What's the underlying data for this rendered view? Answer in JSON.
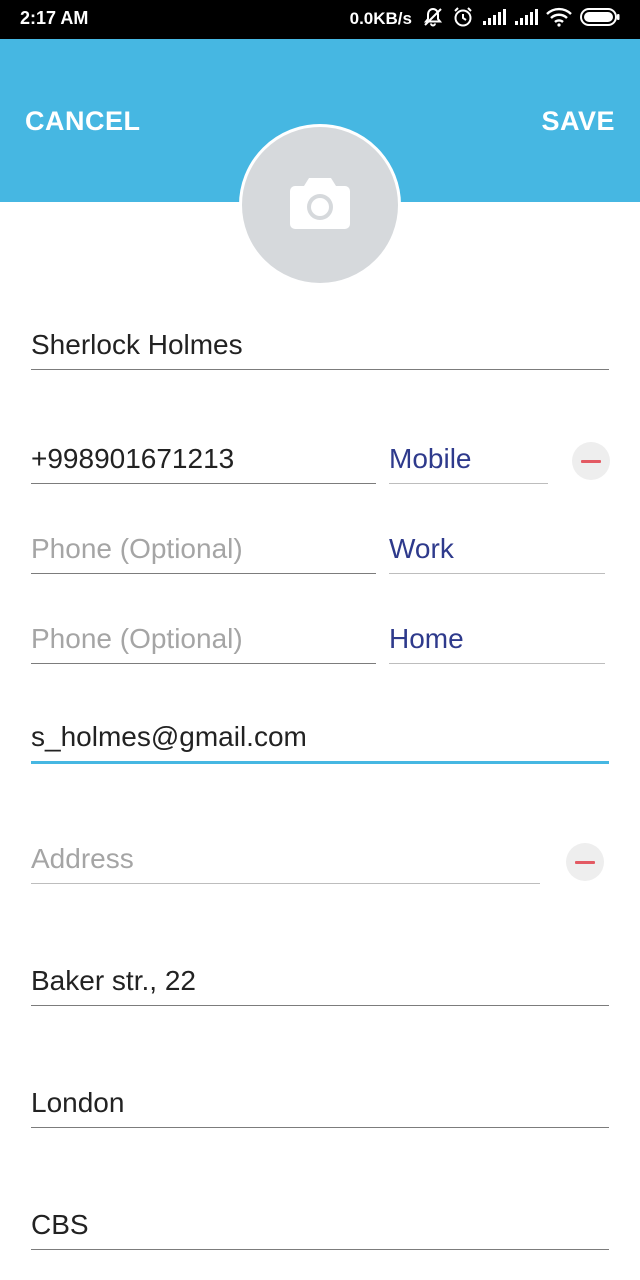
{
  "status_bar": {
    "time": "2:17 AM",
    "network_speed": "0.0KB/s",
    "icons": [
      "mute-icon",
      "alarm-icon",
      "signal-icon",
      "signal-icon",
      "wifi-icon",
      "battery-icon"
    ]
  },
  "header": {
    "cancel_label": "CANCEL",
    "save_label": "SAVE",
    "background_color": "#46b7e2",
    "avatar_icon": "camera-icon"
  },
  "form": {
    "name": {
      "value": "Sherlock Holmes"
    },
    "phones": [
      {
        "value": "+998901671213",
        "placeholder": "Phone (Optional)",
        "type": "Mobile",
        "removable": true
      },
      {
        "value": "",
        "placeholder": "Phone (Optional)",
        "type": "Work",
        "removable": false
      },
      {
        "value": "",
        "placeholder": "Phone (Optional)",
        "type": "Home",
        "removable": false
      }
    ],
    "email": {
      "value": "s_holmes@gmail.com",
      "focused": true
    },
    "address": {
      "value": "",
      "placeholder": "Address",
      "removable": true
    },
    "street": {
      "value": "Baker str., 22"
    },
    "city": {
      "value": "London"
    },
    "region": {
      "value": "CBS"
    }
  },
  "colors": {
    "accent": "#46b7e2",
    "type_label": "#2e3a8c",
    "remove": "#e35a63",
    "placeholder": "#a5a5a5"
  }
}
